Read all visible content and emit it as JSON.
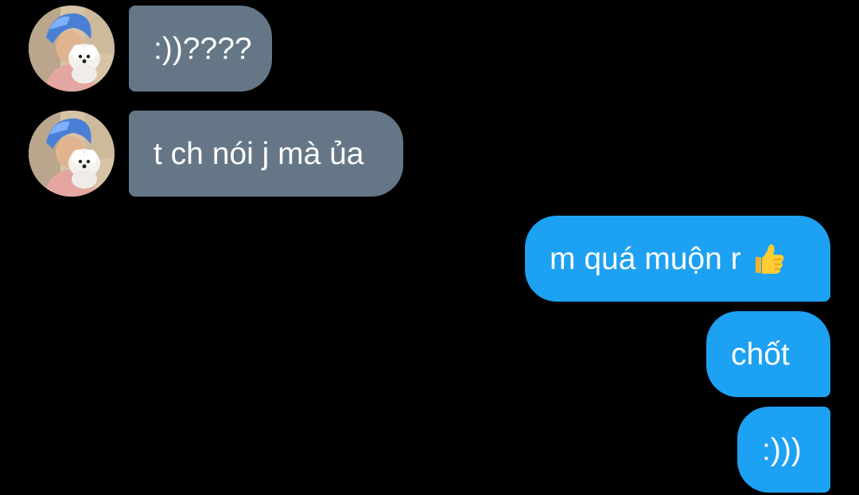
{
  "messages": [
    {
      "direction": "incoming",
      "text": ":))????",
      "avatar": "user-avatar-blue-hair-with-white-dog"
    },
    {
      "direction": "incoming",
      "text": "t ch nói j mà ủa",
      "avatar": "user-avatar-blue-hair-with-white-dog"
    },
    {
      "direction": "outgoing",
      "text": "m quá muộn r",
      "emoji": "thumbs-up-icon"
    },
    {
      "direction": "outgoing",
      "text": "chốt"
    },
    {
      "direction": "outgoing",
      "text": ":)))"
    }
  ],
  "colors": {
    "background": "#000000",
    "incoming_bubble": "#657786",
    "outgoing_bubble": "#1da1f2",
    "text": "#ffffff"
  }
}
